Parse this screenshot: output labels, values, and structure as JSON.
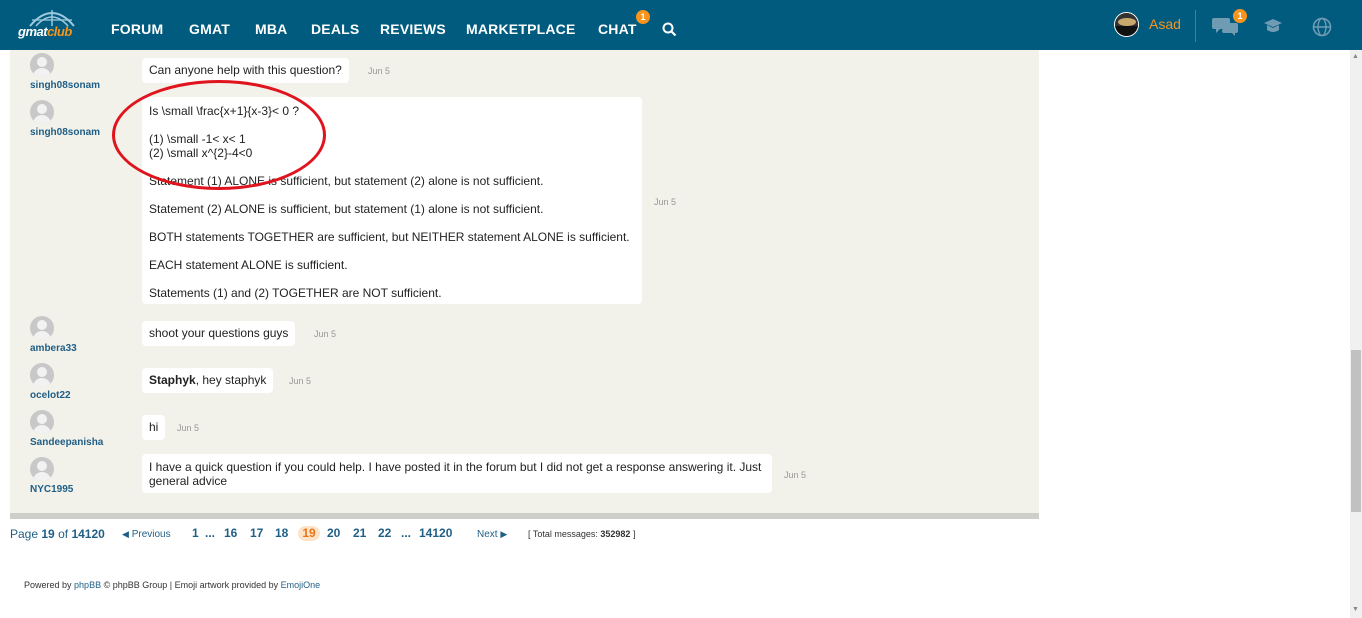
{
  "header": {
    "logo": {
      "part1": "gmat",
      "part2": "club"
    },
    "nav": [
      "FORUM",
      "GMAT",
      "MBA",
      "DEALS",
      "REVIEWS",
      "MARKETPLACE",
      "CHAT"
    ],
    "chat_badge": "1",
    "user": "Asad",
    "messages_badge": "1",
    "icons": [
      "search-icon",
      "chat-bubbles-icon",
      "graduation-cap-icon",
      "globe-icon"
    ]
  },
  "messages": [
    {
      "user": "singh08sonam",
      "text": "Can anyone help with this question?",
      "date": "Jun 5"
    },
    {
      "user": "singh08sonam",
      "lines": [
        "Is \\small \\frac{x+1}{x-3}< 0 ?",
        "(1) \\small -1< x< 1",
        "(2) \\small x^{2}-4<0",
        "Statement (1) ALONE is sufficient, but statement (2) alone is not sufficient.",
        "Statement (2) ALONE is sufficient, but statement (1) alone is not sufficient.",
        "BOTH statements TOGETHER are sufficient, but NEITHER statement ALONE is sufficient.",
        "EACH statement ALONE is sufficient.",
        "Statements (1) and (2) TOGETHER are NOT sufficient."
      ],
      "date": "Jun 5"
    },
    {
      "user": "ambera33",
      "text": "shoot your questions guys",
      "date": "Jun 5"
    },
    {
      "user": "ocelot22",
      "mention": "Staphyk",
      "text": ", hey staphyk",
      "date": "Jun 5"
    },
    {
      "user": "Sandeepanisha",
      "text": "hi",
      "date": "Jun 5"
    },
    {
      "user": "NYC1995",
      "text": "I have a quick question if you could help. I have posted it in the forum but I did not get a response answering it. Just general advice",
      "date": "Jun 5"
    }
  ],
  "pagination": {
    "page_label": "Page",
    "current": "19",
    "of_label": "of",
    "total_pages": "14120",
    "prev": "Previous",
    "next": "Next",
    "pages": [
      "1",
      "16",
      "17",
      "18",
      "19",
      "20",
      "21",
      "22",
      "14120"
    ],
    "ellipsis": "...",
    "total_label": "Total messages:",
    "total_messages": "352982"
  },
  "footer": {
    "powered": "Powered by",
    "phpbb": "phpBB",
    "group": "© phpBB Group | Emoji artwork provided by",
    "emojione": "EmojiOne"
  },
  "colors": {
    "nav_bg": "#005b7f",
    "accent": "#f7941d",
    "link": "#1f5f86",
    "annotation": "#e0141e"
  }
}
